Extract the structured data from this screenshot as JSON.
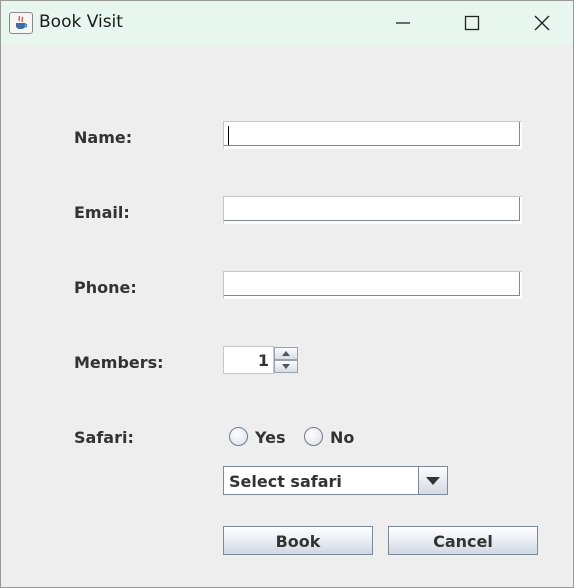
{
  "window": {
    "title": "Book Visit",
    "app_icon": "java-cup-icon",
    "controls": [
      "minimize-icon",
      "maximize-icon",
      "close-icon"
    ]
  },
  "form": {
    "name_label": "Name:",
    "name_value": "",
    "email_label": "Email:",
    "email_value": "",
    "phone_label": "Phone:",
    "phone_value": "",
    "members_label": "Members:",
    "members_value": "1",
    "safari_label": "Safari:",
    "safari_options": [
      "Yes",
      "No"
    ],
    "safari_selected": null,
    "safari_combo_value": "Select safari"
  },
  "buttons": {
    "book_label": "Book",
    "cancel_label": "Cancel"
  },
  "colors": {
    "background": "#eeeeee",
    "titlebar": "#e8f6f0",
    "label_text": "#333333",
    "control_border": "#7a8a99"
  }
}
